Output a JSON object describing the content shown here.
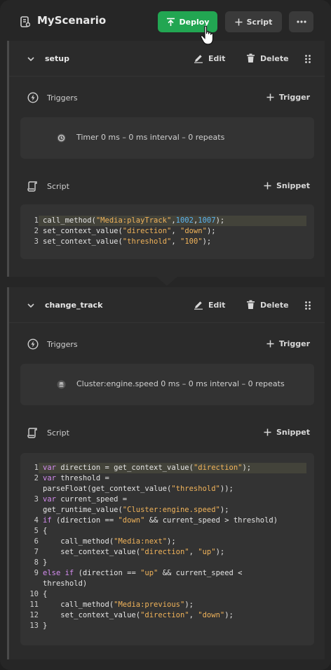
{
  "header": {
    "title": "MyScenario",
    "deploy_label": "Deploy",
    "script_label": "Script",
    "more_label": "···"
  },
  "blocks": [
    {
      "name": "setup",
      "edit_label": "Edit",
      "delete_label": "Delete",
      "triggers_label": "Triggers",
      "add_trigger_label": "Trigger",
      "trigger_text": "Timer 0 ms – 0 ms interval – 0 repeats",
      "trigger_icon": "clock-icon",
      "script_label": "Script",
      "snippet_label": "Snippet",
      "code_lines": [
        "call_method(\"Media:playTrack\",1002,1007);",
        "set_context_value(\"direction\", \"down\");",
        "set_context_value(\"threshold\", \"100\");"
      ]
    },
    {
      "name": "change_track",
      "edit_label": "Edit",
      "delete_label": "Delete",
      "triggers_label": "Triggers",
      "add_trigger_label": "Trigger",
      "trigger_text": "Cluster:engine.speed 0 ms – 0 ms interval – 0 repeats",
      "trigger_icon": "database-icon",
      "script_label": "Script",
      "snippet_label": "Snippet",
      "code_lines": [
        "var direction = get_context_value(\"direction\");",
        "var threshold =",
        "parseFloat(get_context_value(\"threshold\"));",
        "var current_speed =",
        "get_runtime_value(\"Cluster:engine.speed\");",
        "if (direction == \"down\" && current_speed > threshold)",
        "{",
        "    call_method(\"Media:next\");",
        "    set_context_value(\"direction\", \"up\");",
        "}",
        "else if (direction == \"up\" && current_speed <",
        "threshold)",
        "{",
        "    call_method(\"Media:previous\");",
        "    set_context_value(\"direction\", \"down\");",
        "}"
      ],
      "line_numbers": [
        "1",
        "2",
        "",
        "3",
        "",
        "4",
        "5",
        "6",
        "7",
        "8",
        "9",
        "",
        "10",
        "11",
        "12",
        "13"
      ]
    }
  ],
  "colors": {
    "accent_green": "#22a652",
    "keyword": "#d58cf0",
    "string": "#f0b35a",
    "number": "#5ab4f0"
  }
}
